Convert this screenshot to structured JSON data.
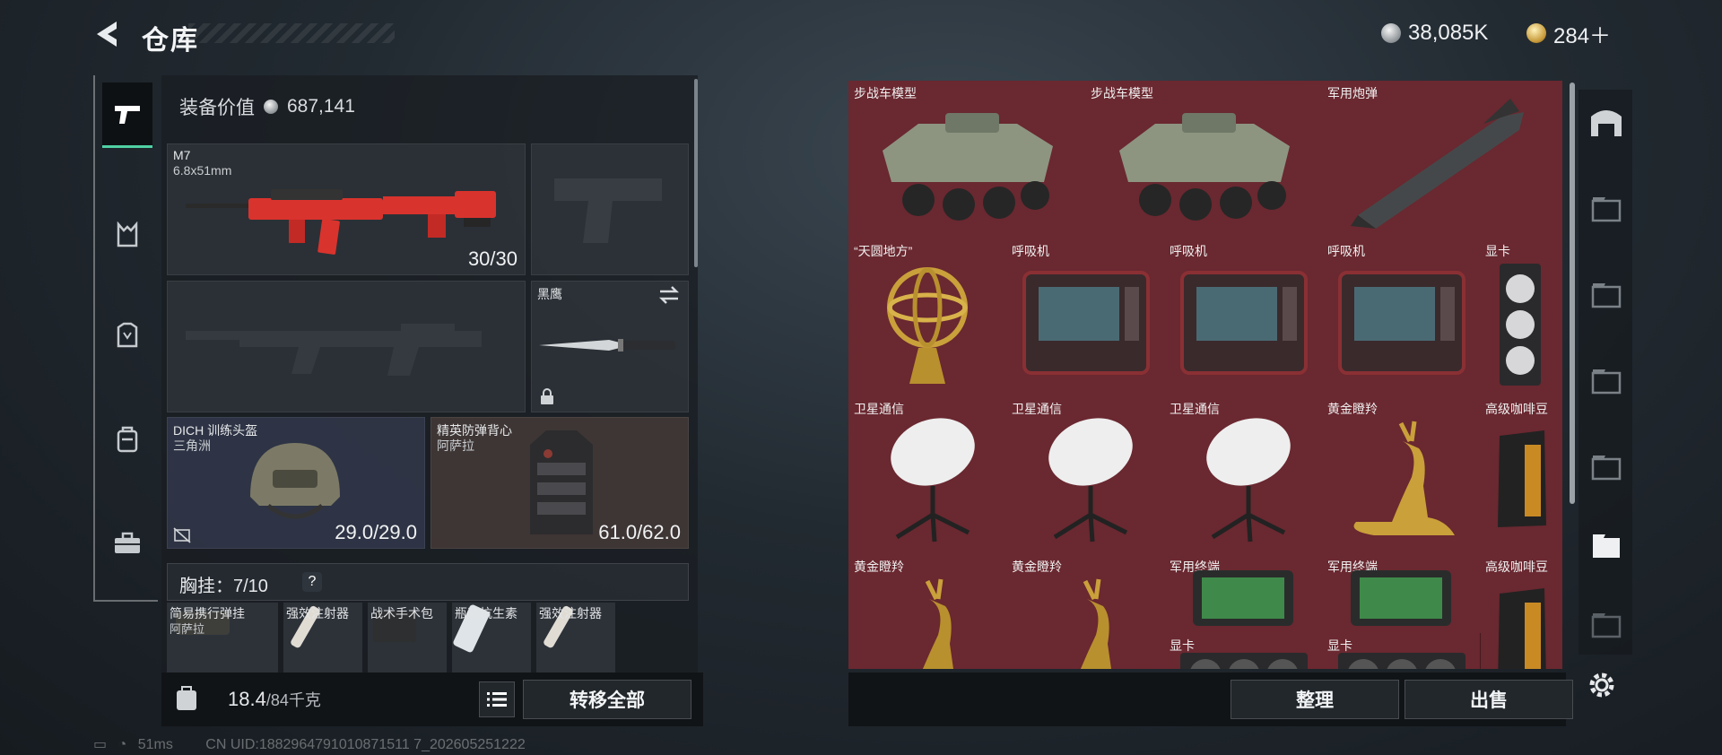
{
  "header": {
    "title": "仓库",
    "currency_silver": "38,085K",
    "currency_gold": "284＋"
  },
  "equipment": {
    "value_label": "装备价值",
    "value": "687,141",
    "primary_weapon": {
      "name": "M7",
      "ammo_type": "6.8x51mm",
      "ammo": "30/30"
    },
    "melee": {
      "name": "黑鹰"
    },
    "helmet": {
      "name": "DICH 训练头盔",
      "map": "三角洲",
      "durability": "29.0/29.0"
    },
    "armor": {
      "name": "精英防弹背心",
      "map": "阿萨拉",
      "durability": "61.0/62.0"
    },
    "chest_rig": {
      "label": "胸挂：7/10",
      "help": "?"
    },
    "chest_items": [
      {
        "name": "简易携行弹挂",
        "sub": "阿萨拉"
      },
      {
        "name": "强效注射器",
        "sub": ""
      },
      {
        "name": "战术手术包",
        "sub": ""
      },
      {
        "name": "瓶装抗生素",
        "sub": ""
      },
      {
        "name": "强效注射器",
        "sub": ""
      }
    ],
    "weight": "18.4",
    "weight_max": "/84千克",
    "transfer_all": "转移全部"
  },
  "storage": {
    "items": [
      "步战车模型",
      "步战车模型",
      "军用炮弹",
      "“天圆地方”",
      "呼吸机",
      "呼吸机",
      "呼吸机",
      "显卡",
      "卫星通信",
      "卫星通信",
      "卫星通信",
      "黄金瞪羚",
      "高级咖啡豆",
      "黄金瞪羚",
      "黄金瞪羚",
      "军用终端",
      "军用终端",
      "高级咖啡豆",
      "显卡",
      "显卡"
    ],
    "sort_button": "整理",
    "sell_button": "出售"
  },
  "status_bar": {
    "ping": "51ms",
    "uid": "CN UID:1882964791010871511 7_202605251222"
  },
  "colors": {
    "accent": "#4fd1a3",
    "cell_red": "#6a2830"
  }
}
